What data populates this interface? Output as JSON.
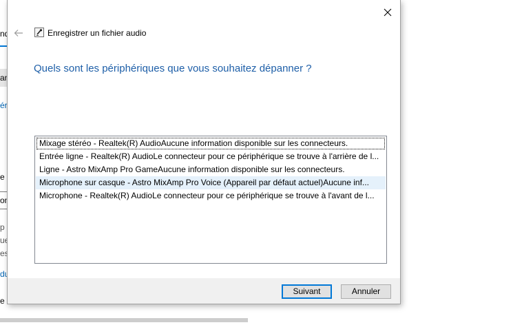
{
  "background_fragments": {
    "top_edge": "p",
    "frag_1": "nd",
    "frag_2": "an",
    "frag_3": "ér",
    "frag_4": "e",
    "frag_5": "on",
    "frag_6": "p",
    "frag_7": "ue",
    "frag_8": "es",
    "frag_9": "du",
    "frag_10": "e"
  },
  "dialog": {
    "title": "Enregistrer un fichier audio",
    "heading": "Quels sont les périphériques que vous souhaitez dépanner ?",
    "devices": [
      "Mixage stéréo - Realtek(R) AudioAucune information disponible sur les connecteurs.",
      "Entrée ligne - Realtek(R) AudioLe connecteur pour ce périphérique se trouve à l'arrière de l...",
      "Ligne - Astro MixAmp Pro GameAucune information disponible sur les connecteurs.",
      "Microphone sur casque - Astro MixAmp Pro Voice (Appareil par défaut actuel)Aucune inf...",
      "Microphone - Realtek(R) AudioLe connecteur pour ce périphérique se trouve à l'avant de l..."
    ],
    "selected_index": 3,
    "focused_index": 0,
    "next_label": "Suivant",
    "cancel_label": "Annuler"
  },
  "icons": {
    "close": "close-icon",
    "back": "back-arrow-icon",
    "title": "microphone-troubleshooter-icon"
  },
  "colors": {
    "heading": "#1e5fa8",
    "selection": "#e5f1fb",
    "default_button_border": "#0078d7",
    "footer": "#f0f0f0"
  }
}
